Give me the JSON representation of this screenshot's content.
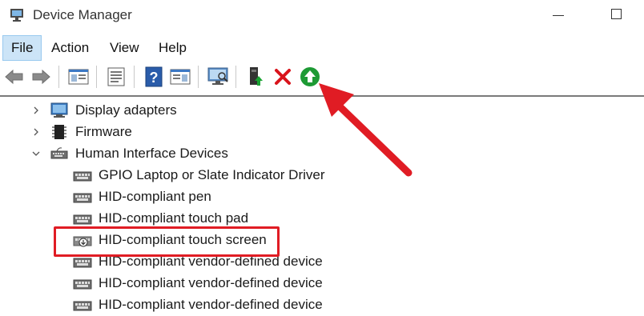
{
  "window": {
    "title": "Device Manager"
  },
  "menu": {
    "file": "File",
    "action": "Action",
    "view": "View",
    "help": "Help"
  },
  "toolbar": {
    "icons": [
      "back-arrow-icon",
      "forward-arrow-icon",
      "properties-pane-icon",
      "console-tree-icon",
      "help-icon",
      "action-pane-icon",
      "scan-hardware-icon",
      "update-driver-icon",
      "uninstall-device-icon",
      "enable-device-icon"
    ]
  },
  "tree": {
    "display_adapters": "Display adapters",
    "firmware": "Firmware",
    "hid": "Human Interface Devices",
    "devices": [
      "GPIO Laptop or Slate Indicator Driver",
      "HID-compliant pen",
      "HID-compliant touch pad",
      "HID-compliant touch screen",
      "HID-compliant vendor-defined device",
      "HID-compliant vendor-defined device",
      "HID-compliant vendor-defined device"
    ]
  },
  "annotation": {
    "highlight_color": "#e01c24",
    "arrow_color": "#e01c24"
  }
}
